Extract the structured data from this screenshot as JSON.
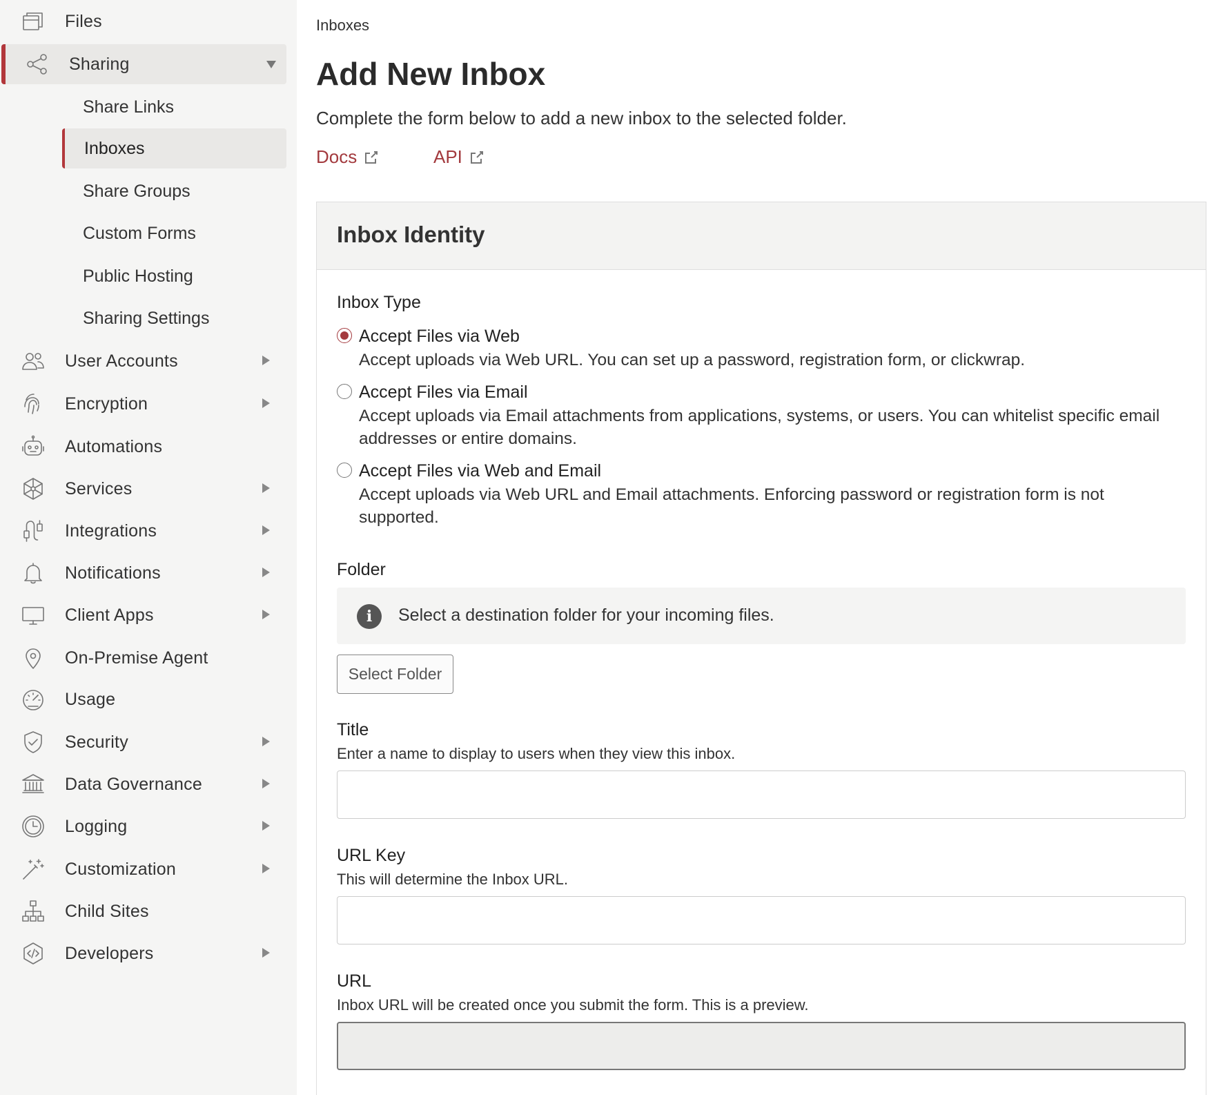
{
  "sidebar": {
    "files": "Files",
    "sharing": "Sharing",
    "sub": {
      "share_links": "Share Links",
      "inboxes": "Inboxes",
      "share_groups": "Share Groups",
      "custom_forms": "Custom Forms",
      "public_hosting": "Public Hosting",
      "sharing_settings": "Sharing Settings"
    },
    "user_accounts": "User Accounts",
    "encryption": "Encryption",
    "automations": "Automations",
    "services": "Services",
    "integrations": "Integrations",
    "notifications": "Notifications",
    "client_apps": "Client Apps",
    "on_premise_agent": "On-Premise Agent",
    "usage": "Usage",
    "security": "Security",
    "data_governance": "Data Governance",
    "logging": "Logging",
    "customization": "Customization",
    "child_sites": "Child Sites",
    "developers": "Developers"
  },
  "main": {
    "breadcrumb": "Inboxes",
    "title": "Add New Inbox",
    "subtitle": "Complete the form below to add a new inbox to the selected folder.",
    "docs_link": "Docs",
    "api_link": "API"
  },
  "form": {
    "card_title": "Inbox Identity",
    "inbox_type_label": "Inbox Type",
    "options": [
      {
        "title": "Accept Files via Web",
        "desc": "Accept uploads via Web URL. You can set up a password, registration form, or clickwrap.",
        "checked": true
      },
      {
        "title": "Accept Files via Email",
        "desc": "Accept uploads via Email attachments from applications, systems, or users. You can whitelist specific email addresses or entire domains.",
        "checked": false
      },
      {
        "title": "Accept Files via Web and Email",
        "desc": "Accept uploads via Web URL and Email attachments. Enforcing password or registration form is not supported.",
        "checked": false
      }
    ],
    "folder_label": "Folder",
    "folder_info": "Select a destination folder for your incoming files.",
    "select_folder_button": "Select Folder",
    "title_label": "Title",
    "title_help": "Enter a name to display to users when they view this inbox.",
    "title_value": "",
    "url_key_label": "URL Key",
    "url_key_help": "This will determine the Inbox URL.",
    "url_key_value": "",
    "url_label": "URL",
    "url_help": "Inbox URL will be created once you submit the form. This is a preview.",
    "url_value": ""
  },
  "colors": {
    "accent": "#a33a3e",
    "sidebar_bg": "#f5f5f4",
    "active_bg": "#e9e8e6"
  }
}
